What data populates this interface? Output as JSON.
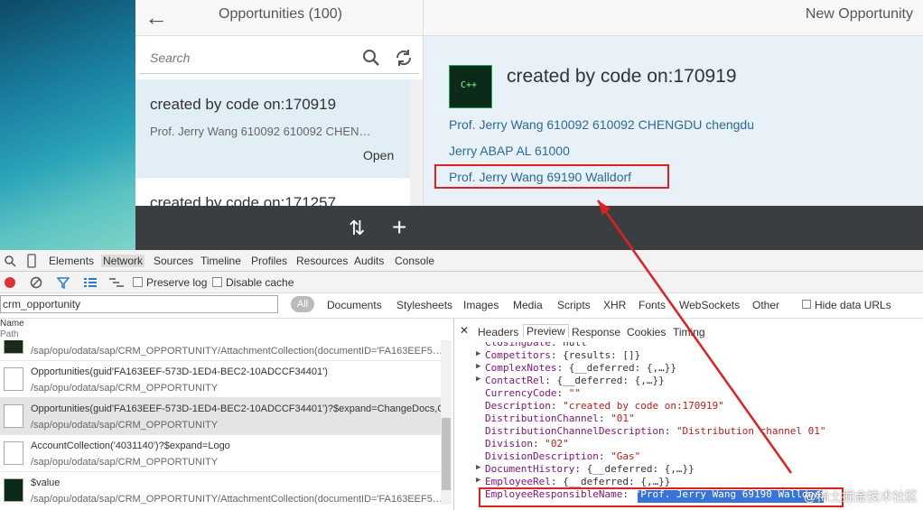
{
  "app": {
    "master_title": "Opportunities (100)",
    "search_placeholder": "Search",
    "detail_header": "New Opportunity"
  },
  "list": [
    {
      "title": "created by code on:170919",
      "subtitle": "Prof. Jerry Wang 610092 610092 CHEN…",
      "status": "Open"
    },
    {
      "title": "created by code on:171257"
    }
  ],
  "detail": {
    "thumb_text": "C++",
    "title": "created by code on:170919",
    "lines": [
      "Prof. Jerry Wang 610092 610092 CHENGDU chengdu",
      "Jerry ABAP AL 61000",
      "Prof. Jerry Wang 69190 Walldorf"
    ]
  },
  "devtools": {
    "tabs": [
      "Elements",
      "Network",
      "Sources",
      "Timeline",
      "Profiles",
      "Resources",
      "Audits",
      "Console"
    ],
    "preserve_log": "Preserve log",
    "disable_cache": "Disable cache",
    "filter_value": "crm_opportunity",
    "filter_types": [
      "All",
      "Documents",
      "Stylesheets",
      "Images",
      "Media",
      "Scripts",
      "XHR",
      "Fonts",
      "WebSockets",
      "Other"
    ],
    "hide_data_urls": "Hide data URLs",
    "col_name": "Name",
    "col_path": "Path",
    "requests": [
      {
        "name": "",
        "path": "/sap/opu/odata/sap/CRM_OPPORTUNITY/AttachmentCollection(documentID='FA163EEF5…"
      },
      {
        "name": "Opportunities(guid'FA163EEF-573D-1ED4-BEC2-10ADCCF34401')",
        "path": "/sap/opu/odata/sap/CRM_OPPORTUNITY"
      },
      {
        "name": "Opportunities(guid'FA163EEF-573D-1ED4-BEC2-10ADCCF34401')?$expand=ChangeDocs,C…",
        "path": "/sap/opu/odata/sap/CRM_OPPORTUNITY"
      },
      {
        "name": "AccountCollection('4031140')?$expand=Logo",
        "path": "/sap/opu/odata/sap/CRM_OPPORTUNITY"
      },
      {
        "name": "$value",
        "path": "/sap/opu/odata/sap/CRM_OPPORTUNITY/AttachmentCollection(documentID='FA163EEF5…"
      }
    ],
    "pane_tabs": [
      "Headers",
      "Preview",
      "Response",
      "Cookies",
      "Timing"
    ],
    "json": [
      {
        "k": "ClosingDate",
        "v": "null",
        "tri": false
      },
      {
        "k": "Competitors",
        "v": "{results: []}",
        "tri": true
      },
      {
        "k": "ComplexNotes",
        "v": "{__deferred: {,…}}",
        "tri": true
      },
      {
        "k": "ContactRel",
        "v": "{__deferred: {,…}}",
        "tri": true
      },
      {
        "k": "CurrencyCode",
        "v": "\"\"",
        "tri": false
      },
      {
        "k": "Description",
        "v": "\"created by code on:170919\"",
        "tri": false
      },
      {
        "k": "DistributionChannel",
        "v": "\"01\"",
        "tri": false
      },
      {
        "k": "DistributionChannelDescription",
        "v": "\"Distribution channel 01\"",
        "tri": false
      },
      {
        "k": "Division",
        "v": "\"02\"",
        "tri": false
      },
      {
        "k": "DivisionDescription",
        "v": "\"Gas\"",
        "tri": false
      },
      {
        "k": "DocumentHistory",
        "v": "{__deferred: {,…}}",
        "tri": true
      },
      {
        "k": "EmployeeRel",
        "v": "{__deferred: {,…}}",
        "tri": true
      },
      {
        "k": "EmployeeResponsibleName",
        "v": "\"Prof. Jerry Wang 69190 Walldorf\"",
        "tri": false
      }
    ],
    "watermark": "@稀土掘金技术社区"
  }
}
